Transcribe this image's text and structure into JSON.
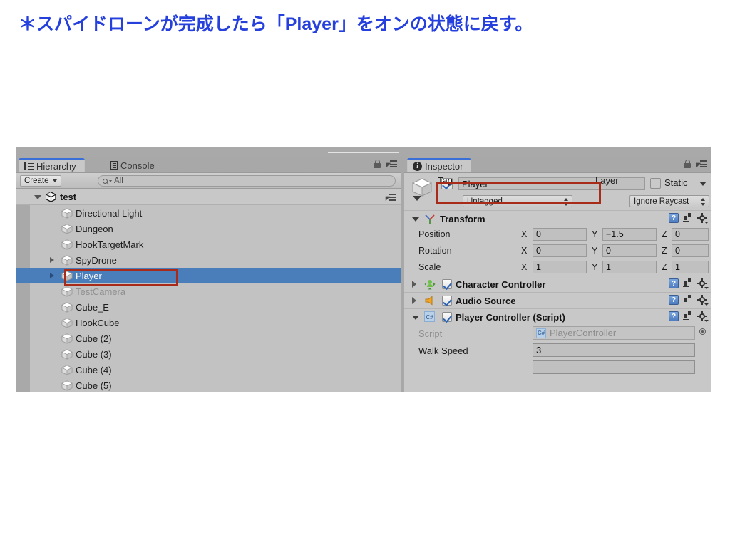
{
  "slide": {
    "title": "＊スパイドローンが完成したら「Player」をオンの状態に戻す。",
    "title_color": "#2540dd"
  },
  "hierarchy_panel": {
    "tabs": [
      {
        "label": "Hierarchy",
        "icon": "hierarchy-list-icon",
        "active": true
      },
      {
        "label": "Console",
        "icon": "console-document-icon",
        "active": false
      }
    ],
    "tools": {
      "lock": "lock-icon",
      "menu": "hamburger-menu-icon"
    },
    "toolbar": {
      "create_label": "Create",
      "create_caret": "chevron-down-icon",
      "search_placeholder": "All",
      "search_value": "",
      "search_icon": "magnifier-icon"
    },
    "scene": {
      "name": "test",
      "icon": "unity-scene-icon",
      "expanded": true
    },
    "items": [
      {
        "label": "Directional Light",
        "indent": 1,
        "twisty": false,
        "selected": false,
        "dim": false
      },
      {
        "label": "Dungeon",
        "indent": 1,
        "twisty": false,
        "selected": false,
        "dim": false
      },
      {
        "label": "HookTargetMark",
        "indent": 1,
        "twisty": false,
        "selected": false,
        "dim": false
      },
      {
        "label": "SpyDrone",
        "indent": 1,
        "twisty": true,
        "selected": false,
        "dim": false
      },
      {
        "label": "Player",
        "indent": 1,
        "twisty": true,
        "selected": true,
        "dim": false
      },
      {
        "label": "TestCamera",
        "indent": 1,
        "twisty": false,
        "selected": false,
        "dim": true
      },
      {
        "label": "Cube_E",
        "indent": 1,
        "twisty": false,
        "selected": false,
        "dim": false
      },
      {
        "label": "HookCube",
        "indent": 1,
        "twisty": false,
        "selected": false,
        "dim": false
      },
      {
        "label": "Cube (2)",
        "indent": 1,
        "twisty": false,
        "selected": false,
        "dim": false
      },
      {
        "label": "Cube (3)",
        "indent": 1,
        "twisty": false,
        "selected": false,
        "dim": false
      },
      {
        "label": "Cube (4)",
        "indent": 1,
        "twisty": false,
        "selected": false,
        "dim": false
      },
      {
        "label": "Cube (5)",
        "indent": 1,
        "twisty": false,
        "selected": false,
        "dim": false
      }
    ]
  },
  "inspector_panel": {
    "tabs": [
      {
        "label": "Inspector",
        "icon": "info-circle-icon",
        "active": true
      }
    ],
    "tools": {
      "lock": "lock-icon",
      "menu": "hamburger-menu-icon"
    },
    "object": {
      "enabled": true,
      "name": "Player",
      "static_label": "Static",
      "static_checked": false,
      "tag_label": "Tag",
      "tag_value": "Untagged",
      "layer_label": "Layer",
      "layer_value": "Ignore Raycast"
    },
    "components": [
      {
        "title": "Transform",
        "icon": "transform-axis-icon",
        "expanded": true,
        "has_checkbox": false,
        "rows": [
          {
            "label": "Position",
            "x": "0",
            "y": "−1.5",
            "z": "0"
          },
          {
            "label": "Rotation",
            "x": "0",
            "y": "0",
            "z": "0"
          },
          {
            "label": "Scale",
            "x": "1",
            "y": "1",
            "z": "1"
          }
        ]
      },
      {
        "title": "Character Controller",
        "icon": "character-controller-icon",
        "expanded": false,
        "has_checkbox": true,
        "checked": true
      },
      {
        "title": "Audio Source",
        "icon": "speaker-icon",
        "expanded": false,
        "has_checkbox": true,
        "checked": true
      },
      {
        "title": "Player Controller (Script)",
        "icon": "csharp-script-icon",
        "expanded": true,
        "has_checkbox": true,
        "checked": true,
        "properties": [
          {
            "label": "Script",
            "type": "object",
            "value": "PlayerController",
            "dim": true
          },
          {
            "label": "Walk Speed",
            "type": "number",
            "value": "3",
            "dim": false
          }
        ]
      }
    ],
    "axis_labels": {
      "x": "X",
      "y": "Y",
      "z": "Z"
    },
    "help_glyph": "?"
  },
  "annotations": {
    "color": "#a82a18",
    "boxes": [
      {
        "name": "hierarchy-player-highlight"
      },
      {
        "name": "inspector-name-highlight"
      }
    ]
  }
}
